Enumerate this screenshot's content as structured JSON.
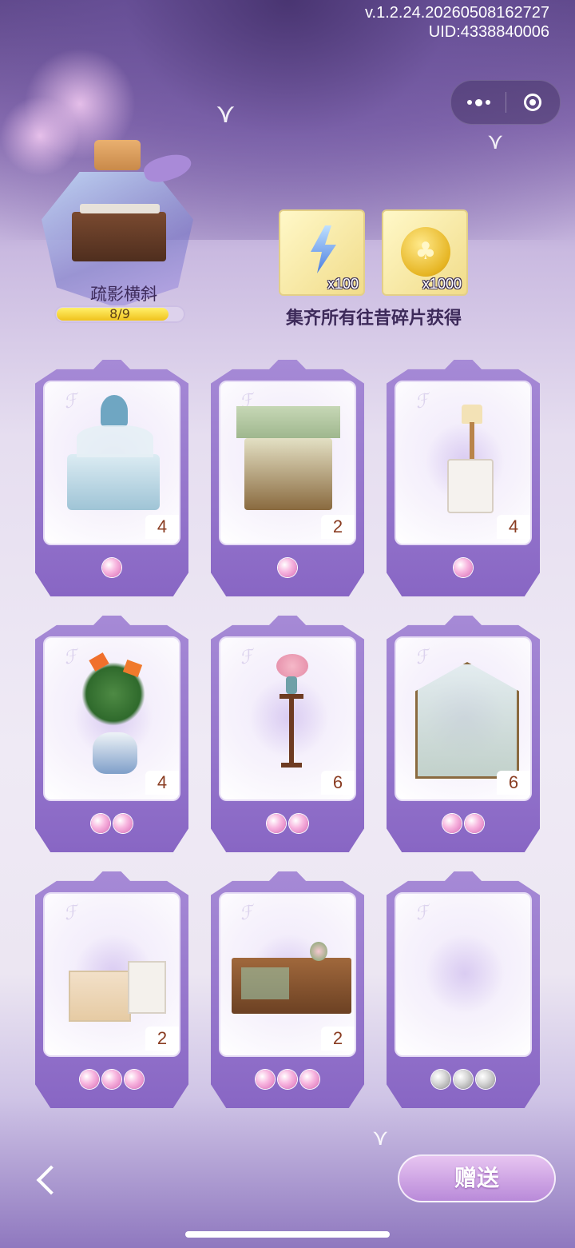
{
  "header": {
    "version": "v.1.2.24.20260508162727",
    "uid": "UID:4338840006"
  },
  "capsule": {
    "more_icon": "more-dots-icon",
    "close_icon": "target-circle-icon"
  },
  "collection": {
    "name": "疏影横斜",
    "progress_text": "8/9",
    "progress_value": 0.889
  },
  "rewards": {
    "items": [
      {
        "icon": "energy-bolt-icon",
        "amount": "x100"
      },
      {
        "icon": "clover-coin-icon",
        "amount": "x1000"
      }
    ],
    "caption": "集齐所有往昔碎片获得"
  },
  "cards": [
    {
      "item": "canopy-bed-blue-icon",
      "count": "4",
      "gems": 1,
      "gem_color": "pink"
    },
    {
      "item": "four-poster-bed-green-icon",
      "count": "2",
      "gems": 1,
      "gem_color": "pink"
    },
    {
      "item": "nightstand-lamp-icon",
      "count": "4",
      "gems": 1,
      "gem_color": "pink"
    },
    {
      "item": "bird-of-paradise-plant-icon",
      "count": "4",
      "gems": 2,
      "gem_color": "pink"
    },
    {
      "item": "flower-vase-stand-icon",
      "count": "6",
      "gems": 2,
      "gem_color": "pink"
    },
    {
      "item": "greenhouse-icon",
      "count": "6",
      "gems": 2,
      "gem_color": "pink"
    },
    {
      "item": "display-counter-icon",
      "count": "2",
      "gems": 3,
      "gem_color": "pink"
    },
    {
      "item": "wooden-shop-counter-icon",
      "count": "2",
      "gems": 3,
      "gem_color": "pink"
    },
    {
      "item": "empty-slot-flower-icon",
      "count": "",
      "gems": 3,
      "gem_color": "grey"
    }
  ],
  "footer": {
    "back_icon": "chevron-left-icon",
    "send_label": "赠送"
  }
}
